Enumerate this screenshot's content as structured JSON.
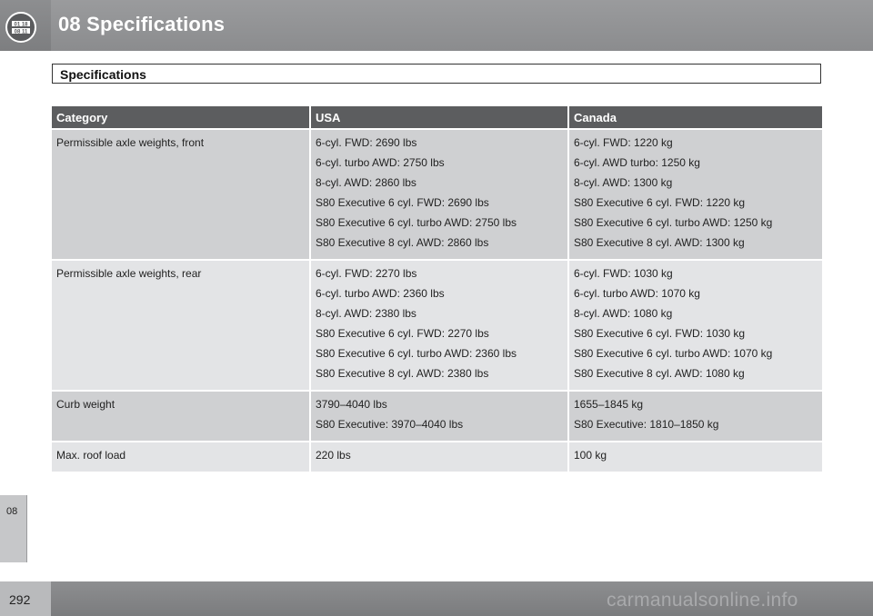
{
  "header": {
    "chapter_icon": "odometer-icon",
    "title": "08  Specifications"
  },
  "side_tab": {
    "label": "08"
  },
  "section": {
    "title": "Specifications"
  },
  "table": {
    "headers": [
      "Category",
      "USA",
      "Canada"
    ],
    "rows": [
      {
        "category": "Permissible axle weights, front",
        "usa": [
          "6-cyl. FWD: 2690 lbs",
          "6-cyl. turbo AWD: 2750 lbs",
          "8-cyl. AWD: 2860 lbs",
          "S80 Executive 6 cyl. FWD: 2690 lbs",
          "S80 Executive 6 cyl. turbo AWD: 2750 lbs",
          "S80 Executive 8 cyl. AWD: 2860 lbs"
        ],
        "canada": [
          "6-cyl. FWD: 1220 kg",
          "6-cyl. AWD turbo: 1250 kg",
          "8-cyl. AWD: 1300 kg",
          "S80 Executive 6 cyl. FWD: 1220 kg",
          "S80 Executive 6 cyl. turbo AWD: 1250 kg",
          "S80 Executive 8 cyl. AWD: 1300 kg"
        ]
      },
      {
        "category": "Permissible axle weights, rear",
        "usa": [
          "6-cyl. FWD: 2270 lbs",
          "6-cyl. turbo AWD: 2360 lbs",
          "8-cyl. AWD: 2380 lbs",
          "S80 Executive 6 cyl. FWD: 2270 lbs",
          "S80 Executive 6 cyl. turbo AWD: 2360 lbs",
          "S80 Executive 8 cyl. AWD: 2380 lbs"
        ],
        "canada": [
          "6-cyl. FWD: 1030 kg",
          "6-cyl. turbo AWD: 1070 kg",
          "8-cyl. AWD: 1080 kg",
          "S80 Executive 6 cyl. FWD: 1030 kg",
          "S80 Executive 6 cyl. turbo AWD: 1070 kg",
          "S80 Executive 8 cyl. AWD: 1080 kg"
        ]
      },
      {
        "category": "Curb weight",
        "usa": [
          "3790–4040 lbs",
          "S80 Executive: 3970–4040 lbs"
        ],
        "canada": [
          "1655–1845 kg",
          "S80 Executive: 1810–1850 kg"
        ]
      },
      {
        "category": "Max. roof load",
        "usa": [
          "220 lbs"
        ],
        "canada": [
          "100 kg"
        ]
      }
    ]
  },
  "footer": {
    "page_number": "292",
    "watermark": "carmanualsonline.info"
  },
  "colors": {
    "header_bg": "#8b8c8e",
    "table_header_bg": "#5c5d5f",
    "row_dark": "#cfd0d2",
    "row_light": "#e3e4e6"
  }
}
